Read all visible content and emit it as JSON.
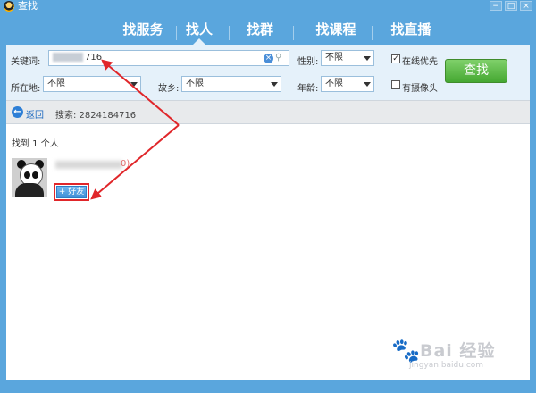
{
  "window": {
    "title": "查找",
    "controls": [
      "−",
      "□",
      "×"
    ]
  },
  "tabs": [
    {
      "label": "找服务",
      "active": false
    },
    {
      "label": "找人",
      "active": true
    },
    {
      "label": "找群",
      "active": false
    },
    {
      "label": "找课程",
      "active": false
    },
    {
      "label": "找直播",
      "active": false
    }
  ],
  "filters": {
    "keyword_label": "关键词:",
    "keyword_value": "716",
    "gender_label": "性别:",
    "gender_value": "不限",
    "online_first_label": "在线优先",
    "online_first_checked": true,
    "location_label": "所在地:",
    "location_value": "不限",
    "hometown_label": "故乡:",
    "hometown_value": "不限",
    "age_label": "年龄:",
    "age_value": "不限",
    "has_camera_label": "有摄像头",
    "has_camera_checked": false,
    "find_button": "查找"
  },
  "backbar": {
    "back_label": "返回",
    "search_summary": "搜索: 2824184716"
  },
  "results": {
    "count_text": "找到 1 个人",
    "items": [
      {
        "name_suffix": "0)",
        "add_friend_label": "+ 好友"
      }
    ]
  },
  "watermark": {
    "brand": "Bai 经验",
    "url": "jingyan.baidu.com"
  },
  "colors": {
    "header_blue": "#5aa6dd",
    "filter_bg": "#e5f1fa",
    "find_green": "#45a832",
    "annotation_red": "#e0262a"
  }
}
